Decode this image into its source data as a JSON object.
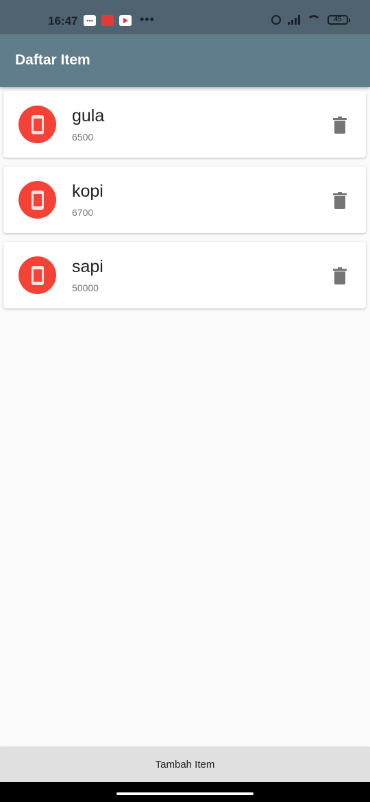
{
  "status_bar": {
    "time": "16:47",
    "battery": "45",
    "icons_left": [
      "message-icon",
      "app-notification-icon",
      "youtube-icon"
    ],
    "icons_right": [
      "alarm-icon",
      "signal-icon",
      "wifi-icon",
      "battery-icon"
    ]
  },
  "app_bar": {
    "title": "Daftar Item",
    "color": "#607d8b"
  },
  "items": [
    {
      "name": "gula",
      "price": "6500",
      "icon": "phone-icon"
    },
    {
      "name": "kopi",
      "price": "6700",
      "icon": "phone-icon"
    },
    {
      "name": "sapi",
      "price": "50000",
      "icon": "phone-icon"
    }
  ],
  "avatar_color": "#f44336",
  "bottom_button": {
    "label": "Tambah Item"
  }
}
